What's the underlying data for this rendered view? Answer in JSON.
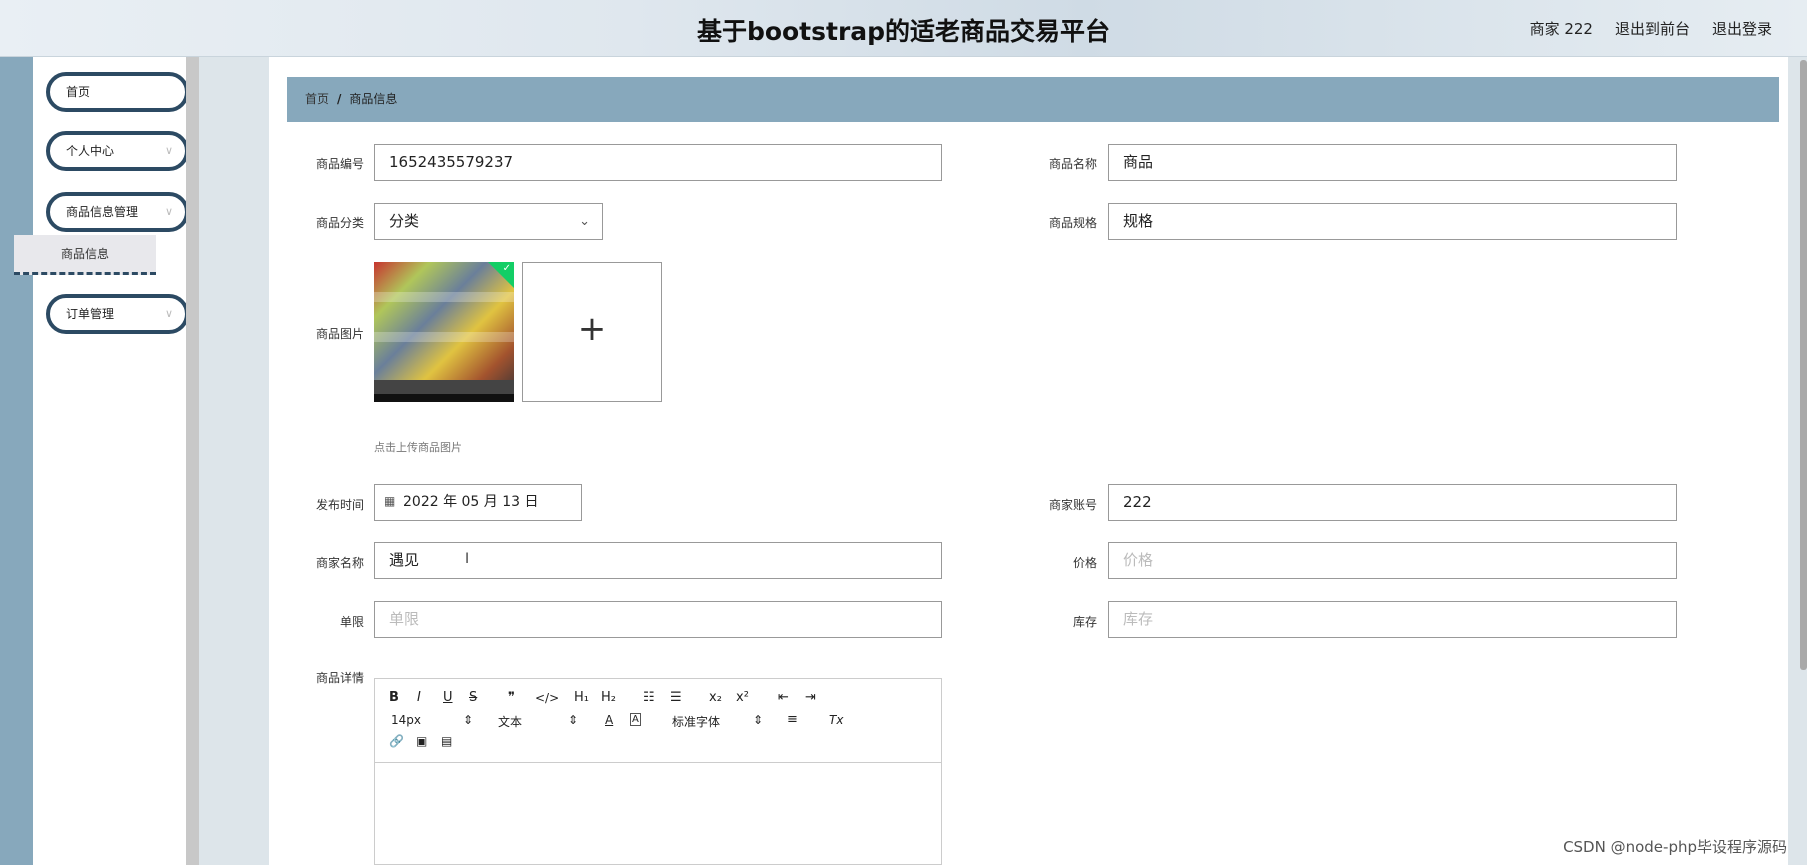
{
  "header": {
    "title": "基于bootstrap的适老商品交易平台",
    "user_label": "商家 222",
    "front_link": "退出到前台",
    "logout_link": "退出登录"
  },
  "sidebar": {
    "items": [
      {
        "label": "首页"
      },
      {
        "label": "个人中心"
      },
      {
        "label": "商品信息管理"
      },
      {
        "label": "订单管理"
      }
    ],
    "sub_item": "商品信息"
  },
  "breadcrumb": {
    "home": "首页",
    "sep": "/",
    "current": "商品信息"
  },
  "form": {
    "code_label": "商品编号",
    "code_value": "1652435579237",
    "name_label": "商品名称",
    "name_value": "商品",
    "category_label": "商品分类",
    "category_value": "分类",
    "spec_label": "商品规格",
    "spec_value": "规格",
    "image_label": "商品图片",
    "image_hint": "点击上传商品图片",
    "publish_label": "发布时间",
    "publish_value": "2022 年 05 月 13 日",
    "merchant_account_label": "商家账号",
    "merchant_account_value": "222",
    "merchant_name_label": "商家名称",
    "merchant_name_value": "遇见",
    "price_label": "价格",
    "price_placeholder": "价格",
    "limit_label": "单限",
    "limit_placeholder": "单限",
    "stock_label": "库存",
    "stock_placeholder": "库存",
    "detail_label": "商品详情"
  },
  "editor": {
    "bold": "B",
    "italic": "I",
    "underline": "U",
    "strike": "S",
    "quote": "❞",
    "code": "</>",
    "h1": "H₁",
    "h2": "H₂",
    "ordered_list": "☷",
    "bullet_list": "☰",
    "subscript": "x₂",
    "superscript": "x²",
    "outdent": "⇤",
    "indent": "⇥",
    "font_size": "14px",
    "text_style": "文本",
    "font_color": "A",
    "bg_color": "A",
    "font_family": "标准字体",
    "align": "≡",
    "clear_format": "Tx",
    "link": "🔗",
    "image": "▣",
    "video": "▤"
  },
  "watermark": "CSDN @node-php毕设程序源码"
}
